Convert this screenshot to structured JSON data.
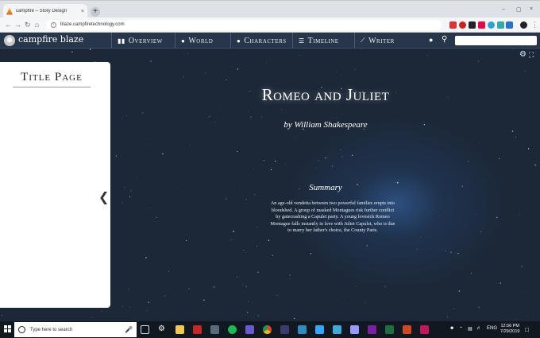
{
  "browser": {
    "tab_title": "campfire – Story Design",
    "tab_close": "×",
    "new_tab": "+",
    "url": "blaze.campfiretechnology.com",
    "window_controls": [
      "–",
      "▢",
      "×"
    ],
    "nav": {
      "back": "←",
      "forward": "→",
      "reload": "↻",
      "home": "⌂"
    }
  },
  "app": {
    "brand": "campfire blaze",
    "nav_items": [
      {
        "label": "Overview",
        "icon": "book-icon"
      },
      {
        "label": "World",
        "icon": "globe-icon"
      },
      {
        "label": "Characters",
        "icon": "person-icon"
      },
      {
        "label": "Timeline",
        "icon": "timeline-icon"
      },
      {
        "label": "Writer",
        "icon": "pen-icon"
      }
    ],
    "search_value": ""
  },
  "panel": {
    "title": "Title Page"
  },
  "story": {
    "title": "Romeo and Juliet",
    "byline": "by William Shakespeare",
    "summary_heading": "Summary",
    "summary_text": "An age-old vendetta between two powerful families erupts into bloodshed. A group of masked Montagues risk further conflict by gatecrashing a Capulet party. A young lovesick Romeo Montague falls instantly in love with Juliet Capulet, who is due to marry her father's choice, the County Paris."
  },
  "taskbar": {
    "search_placeholder": "Type here to search",
    "language": "ENG",
    "time": "12:56 PM",
    "date": "7/29/2019"
  },
  "colors": {
    "app_nav_bg": "#27364a",
    "main_bg": "#1c2838",
    "taskbar_bg": "#101820"
  }
}
